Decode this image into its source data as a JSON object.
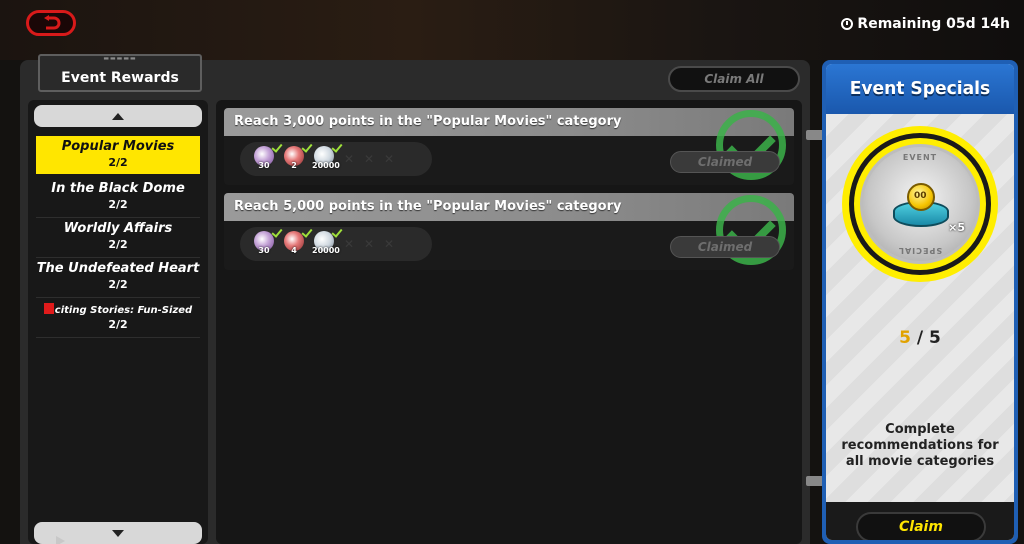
{
  "header": {
    "back_icon": "back-arrow-icon",
    "remaining": "Remaining 05d 14h"
  },
  "tab": {
    "label": "Event Rewards"
  },
  "claim_all": "Claim All",
  "categories": [
    {
      "name": "Popular Movies",
      "count": "2/2",
      "active": true
    },
    {
      "name": "In the Black Dome",
      "count": "2/2"
    },
    {
      "name": "Worldly Affairs",
      "count": "2/2"
    },
    {
      "name": "The Undefeated Heart",
      "count": "2/2"
    },
    {
      "name": "Exciting Stories: Fun-Sized",
      "display_name": "citing Stories: Fun-Sized",
      "count": "2/2",
      "new": true
    }
  ],
  "missions": [
    {
      "title": "Reach 3,000 points in the \"Popular Movies\" category",
      "rewards": [
        {
          "qty": "30"
        },
        {
          "qty": "2"
        },
        {
          "qty": "20000"
        }
      ],
      "status": "Claimed"
    },
    {
      "title": "Reach 5,000 points in the \"Popular Movies\" category",
      "rewards": [
        {
          "qty": "30"
        },
        {
          "qty": "4"
        },
        {
          "qty": "20000"
        }
      ],
      "status": "Claimed"
    }
  ],
  "specials": {
    "title": "Event Specials",
    "medal_top": "EVENT",
    "medal_bottom": "SPECIAL",
    "medal_qty": "×5",
    "progress_current": "5",
    "progress_sep": " / ",
    "progress_total": "5",
    "description": "Complete recommendations for all movie categories",
    "claim": "Claim"
  },
  "colors": {
    "accent_yellow": "#ffe600",
    "specials_blue": "#1f5fb4",
    "check_green": "#3cb24a",
    "back_red": "#d81a1a"
  }
}
